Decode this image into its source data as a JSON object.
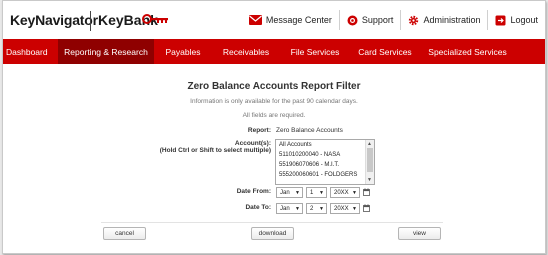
{
  "header": {
    "brand": "KeyNavigator",
    "brand2": "KeyBank",
    "links": [
      {
        "label": "Message Center",
        "icon": "envelope-icon"
      },
      {
        "label": "Support",
        "icon": "lifebuoy-icon"
      },
      {
        "label": "Administration",
        "icon": "gear-icon"
      },
      {
        "label": "Logout",
        "icon": "logout-icon"
      }
    ]
  },
  "nav": {
    "items": [
      {
        "label": "Dashboard"
      },
      {
        "label": "Reporting & Research",
        "active": true
      },
      {
        "label": "Payables"
      },
      {
        "label": "Receivables"
      },
      {
        "label": "File Services"
      },
      {
        "label": "Card Services"
      },
      {
        "label": "Specialized Services"
      }
    ]
  },
  "form": {
    "title": "Zero Balance Accounts Report Filter",
    "info": "Information is only available for the past 90 calendar days.",
    "required": "All fields are required.",
    "report_label": "Report:",
    "report_value": "Zero Balance Accounts",
    "accounts_label": "Account(s):",
    "accounts_hint": "(Hold Ctrl or Shift to select multiple)",
    "accounts": [
      "All Accounts",
      "511010200040 - NASA",
      "551906070606 - M.I.T.",
      "555200060601 - FOLDGERS"
    ],
    "date_from_label": "Date From:",
    "date_from": {
      "month": "Jan",
      "day": "1",
      "year": "20XX"
    },
    "date_to_label": "Date To:",
    "date_to": {
      "month": "Jan",
      "day": "2",
      "year": "20XX"
    }
  },
  "buttons": {
    "cancel": "cancel",
    "download": "download",
    "view": "view"
  },
  "colors": {
    "brand_red": "#cc0000",
    "active_nav": "#8f0000"
  }
}
